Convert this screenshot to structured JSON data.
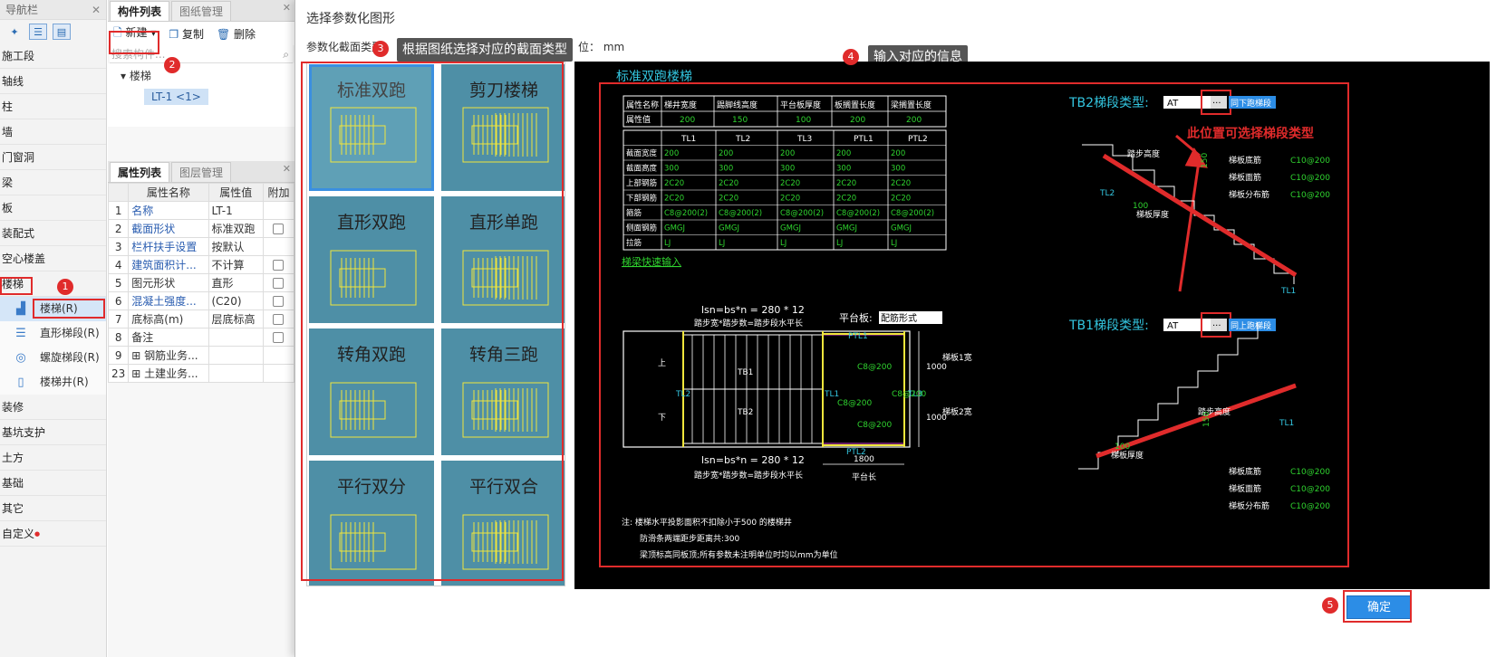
{
  "nav": {
    "title": "导航栏",
    "items": [
      "施工段",
      "轴线",
      "柱",
      "墙",
      "门窗洞",
      "梁",
      "板",
      "装配式",
      "空心楼盖",
      "楼梯"
    ],
    "sub_items": [
      "楼梯(R)",
      "直形梯段(R)",
      "螺旋梯段(R)",
      "楼梯井(R)"
    ],
    "items_after": [
      "装修",
      "基坑支护",
      "土方",
      "基础",
      "其它",
      "自定义"
    ]
  },
  "component_panel": {
    "tabs": [
      "构件列表",
      "图纸管理"
    ],
    "new_label": "新建",
    "copy_label": "复制",
    "delete_label": "删除",
    "search_placeholder": "搜索构件...",
    "tree_root": "楼梯",
    "tree_leaf": "LT-1 <1>"
  },
  "property_panel": {
    "tabs": [
      "属性列表",
      "图层管理"
    ],
    "columns": [
      "属性名称",
      "属性值",
      "附加"
    ],
    "rows": [
      {
        "no": "1",
        "name": "名称",
        "value": "LT-1",
        "check": false,
        "blue": true
      },
      {
        "no": "2",
        "name": "截面形状",
        "value": "标准双跑",
        "check": true,
        "blue": true
      },
      {
        "no": "3",
        "name": "栏杆扶手设置",
        "value": "按默认",
        "check": false,
        "blue": true
      },
      {
        "no": "4",
        "name": "建筑面积计...",
        "value": "不计算",
        "check": true,
        "blue": true
      },
      {
        "no": "5",
        "name": "图元形状",
        "value": "直形",
        "check": true,
        "blue": false
      },
      {
        "no": "6",
        "name": "混凝土强度...",
        "value": "(C20)",
        "check": true,
        "blue": true
      },
      {
        "no": "7",
        "name": "底标高(m)",
        "value": "层底标高",
        "check": true,
        "blue": false
      },
      {
        "no": "8",
        "name": "备注",
        "value": "",
        "check": true,
        "blue": false
      },
      {
        "no": "9",
        "name": "钢筋业务...",
        "value": "",
        "check": false,
        "blue": false,
        "expand": true
      },
      {
        "no": "23",
        "name": "土建业务...",
        "value": "",
        "check": false,
        "blue": false,
        "expand": true
      }
    ]
  },
  "dialog": {
    "title": "选择参数化图形",
    "section_label": "参数化截面类型",
    "unit_label": "位： mm",
    "tip3": "根据图纸选择对应的截面类型",
    "tip4": "输入对应的信息",
    "ok_label": "确定",
    "gallery": [
      "标准双跑",
      "剪刀楼梯",
      "直形双跑",
      "直形单跑",
      "转角双跑",
      "转角三跑",
      "平行双分",
      "平行双合"
    ]
  },
  "badges": [
    "1",
    "2",
    "3",
    "4",
    "5"
  ],
  "preview": {
    "title": "标准双跑楼梯",
    "params_header": [
      "属性名称",
      "梯井宽度",
      "踢脚线高度",
      "平台板厚度",
      "板搁置长度",
      "梁搁置长度"
    ],
    "params_values": [
      "属性值",
      "200",
      "150",
      "100",
      "200",
      "200"
    ],
    "beam_header": [
      "",
      "TL1",
      "TL2",
      "TL3",
      "PTL1",
      "PTL2"
    ],
    "beam_rows": [
      [
        "截面宽度",
        "200",
        "200",
        "200",
        "200",
        "200"
      ],
      [
        "截面高度",
        "300",
        "300",
        "300",
        "300",
        "300"
      ],
      [
        "上部钢筋",
        "2C20",
        "2C20",
        "2C20",
        "2C20",
        "2C20"
      ],
      [
        "下部钢筋",
        "2C20",
        "2C20",
        "2C20",
        "2C20",
        "2C20"
      ],
      [
        "箍筋",
        "C8@200(2)",
        "C8@200(2)",
        "C8@200(2)",
        "C8@200(2)",
        "C8@200(2)"
      ],
      [
        "侧面钢筋",
        "GMGJ",
        "GMGJ",
        "GMGJ",
        "GMGJ",
        "GMGJ"
      ],
      [
        "拉筋",
        "LJ",
        "LJ",
        "LJ",
        "LJ",
        "LJ"
      ]
    ],
    "quick_input": "梯梁快速输入",
    "lsn_formula": "lsn=bs*n = 280 * 12",
    "lsn_caption": "踏步宽*踏步数=踏步段水平长",
    "platform_label": "平台板:",
    "platform_value": "配筋形式",
    "tb2_label": "TB2梯段类型:",
    "tb2_value": "AT",
    "tb2_btn": "同下跑梯段",
    "tb1_label": "TB1梯段类型:",
    "tb1_value": "AT",
    "tb1_btn": "同上跑梯段",
    "red_note": "此位置可选择梯段类型",
    "bar_labels": [
      "梯板底筋",
      "梯板面筋",
      "梯板分布筋"
    ],
    "bar_values": [
      "C10@200",
      "C10@200",
      "C10@200"
    ],
    "step_height": "踏步高度",
    "slab_thick": "梯板厚度",
    "thick_value": "100",
    "step_h_value": "150",
    "plan_labels": {
      "tl1": "TL1",
      "tl2": "TL2",
      "tl3": "TL3",
      "ptl1": "PTL1",
      "ptl2": "PTL2",
      "tb1": "TB1",
      "tb2": "TB2",
      "up": "上",
      "down": "下",
      "dim1800": "1800",
      "dim1000a": "1000",
      "dim1000b": "1000",
      "pt_len": "平台长",
      "w1": "梯板1宽",
      "w2": "梯板2宽",
      "c8a": "C8@200",
      "c8b": "C8@200",
      "c8c": "C8@200",
      "c8d": "C8@200"
    },
    "notes": [
      "注: 楼梯水平投影面积不扣除小于500 的楼梯井",
      "防滑条两端距步距离共:300",
      "梁顶标高同板顶;所有参数未注明单位时均以mm为单位"
    ]
  }
}
